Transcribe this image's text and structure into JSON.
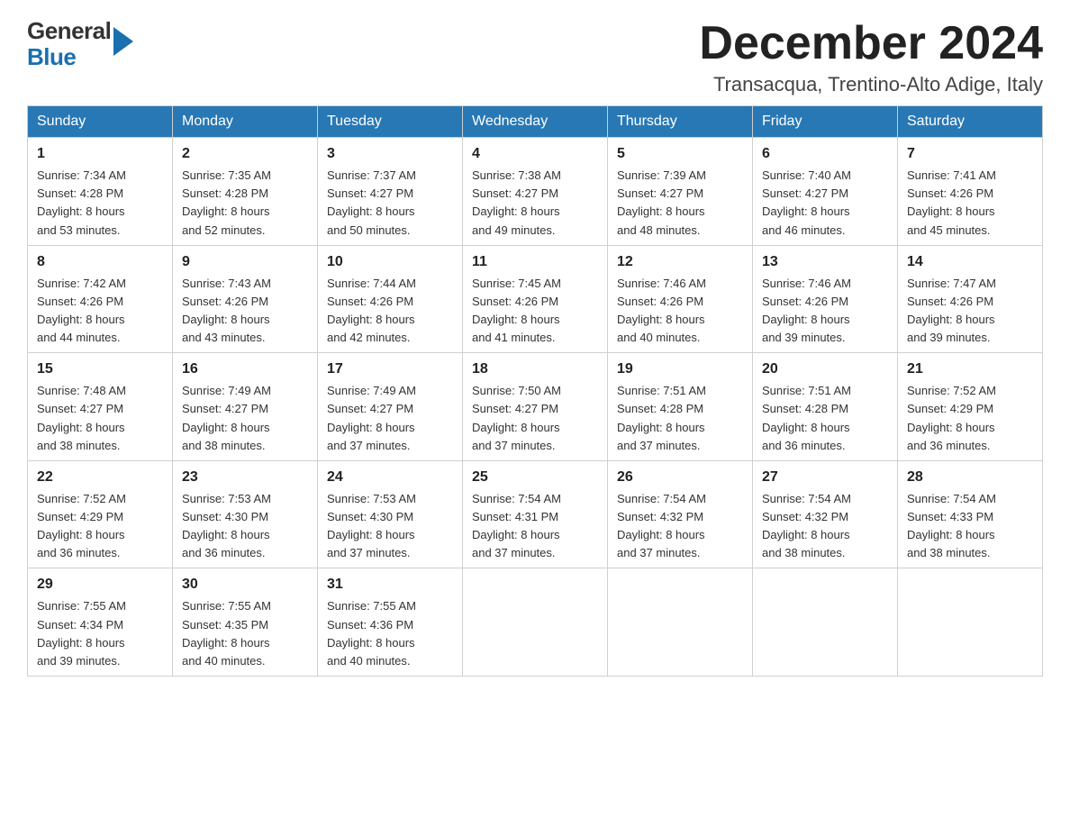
{
  "logo": {
    "line1": "General",
    "line2": "Blue"
  },
  "header": {
    "month": "December 2024",
    "location": "Transacqua, Trentino-Alto Adige, Italy"
  },
  "days_of_week": [
    "Sunday",
    "Monday",
    "Tuesday",
    "Wednesday",
    "Thursday",
    "Friday",
    "Saturday"
  ],
  "weeks": [
    [
      {
        "date": "1",
        "sunrise": "7:34 AM",
        "sunset": "4:28 PM",
        "daylight": "8 hours and 53 minutes."
      },
      {
        "date": "2",
        "sunrise": "7:35 AM",
        "sunset": "4:28 PM",
        "daylight": "8 hours and 52 minutes."
      },
      {
        "date": "3",
        "sunrise": "7:37 AM",
        "sunset": "4:27 PM",
        "daylight": "8 hours and 50 minutes."
      },
      {
        "date": "4",
        "sunrise": "7:38 AM",
        "sunset": "4:27 PM",
        "daylight": "8 hours and 49 minutes."
      },
      {
        "date": "5",
        "sunrise": "7:39 AM",
        "sunset": "4:27 PM",
        "daylight": "8 hours and 48 minutes."
      },
      {
        "date": "6",
        "sunrise": "7:40 AM",
        "sunset": "4:27 PM",
        "daylight": "8 hours and 46 minutes."
      },
      {
        "date": "7",
        "sunrise": "7:41 AM",
        "sunset": "4:26 PM",
        "daylight": "8 hours and 45 minutes."
      }
    ],
    [
      {
        "date": "8",
        "sunrise": "7:42 AM",
        "sunset": "4:26 PM",
        "daylight": "8 hours and 44 minutes."
      },
      {
        "date": "9",
        "sunrise": "7:43 AM",
        "sunset": "4:26 PM",
        "daylight": "8 hours and 43 minutes."
      },
      {
        "date": "10",
        "sunrise": "7:44 AM",
        "sunset": "4:26 PM",
        "daylight": "8 hours and 42 minutes."
      },
      {
        "date": "11",
        "sunrise": "7:45 AM",
        "sunset": "4:26 PM",
        "daylight": "8 hours and 41 minutes."
      },
      {
        "date": "12",
        "sunrise": "7:46 AM",
        "sunset": "4:26 PM",
        "daylight": "8 hours and 40 minutes."
      },
      {
        "date": "13",
        "sunrise": "7:46 AM",
        "sunset": "4:26 PM",
        "daylight": "8 hours and 39 minutes."
      },
      {
        "date": "14",
        "sunrise": "7:47 AM",
        "sunset": "4:26 PM",
        "daylight": "8 hours and 39 minutes."
      }
    ],
    [
      {
        "date": "15",
        "sunrise": "7:48 AM",
        "sunset": "4:27 PM",
        "daylight": "8 hours and 38 minutes."
      },
      {
        "date": "16",
        "sunrise": "7:49 AM",
        "sunset": "4:27 PM",
        "daylight": "8 hours and 38 minutes."
      },
      {
        "date": "17",
        "sunrise": "7:49 AM",
        "sunset": "4:27 PM",
        "daylight": "8 hours and 37 minutes."
      },
      {
        "date": "18",
        "sunrise": "7:50 AM",
        "sunset": "4:27 PM",
        "daylight": "8 hours and 37 minutes."
      },
      {
        "date": "19",
        "sunrise": "7:51 AM",
        "sunset": "4:28 PM",
        "daylight": "8 hours and 37 minutes."
      },
      {
        "date": "20",
        "sunrise": "7:51 AM",
        "sunset": "4:28 PM",
        "daylight": "8 hours and 36 minutes."
      },
      {
        "date": "21",
        "sunrise": "7:52 AM",
        "sunset": "4:29 PM",
        "daylight": "8 hours and 36 minutes."
      }
    ],
    [
      {
        "date": "22",
        "sunrise": "7:52 AM",
        "sunset": "4:29 PM",
        "daylight": "8 hours and 36 minutes."
      },
      {
        "date": "23",
        "sunrise": "7:53 AM",
        "sunset": "4:30 PM",
        "daylight": "8 hours and 36 minutes."
      },
      {
        "date": "24",
        "sunrise": "7:53 AM",
        "sunset": "4:30 PM",
        "daylight": "8 hours and 37 minutes."
      },
      {
        "date": "25",
        "sunrise": "7:54 AM",
        "sunset": "4:31 PM",
        "daylight": "8 hours and 37 minutes."
      },
      {
        "date": "26",
        "sunrise": "7:54 AM",
        "sunset": "4:32 PM",
        "daylight": "8 hours and 37 minutes."
      },
      {
        "date": "27",
        "sunrise": "7:54 AM",
        "sunset": "4:32 PM",
        "daylight": "8 hours and 38 minutes."
      },
      {
        "date": "28",
        "sunrise": "7:54 AM",
        "sunset": "4:33 PM",
        "daylight": "8 hours and 38 minutes."
      }
    ],
    [
      {
        "date": "29",
        "sunrise": "7:55 AM",
        "sunset": "4:34 PM",
        "daylight": "8 hours and 39 minutes."
      },
      {
        "date": "30",
        "sunrise": "7:55 AM",
        "sunset": "4:35 PM",
        "daylight": "8 hours and 40 minutes."
      },
      {
        "date": "31",
        "sunrise": "7:55 AM",
        "sunset": "4:36 PM",
        "daylight": "8 hours and 40 minutes."
      },
      null,
      null,
      null,
      null
    ]
  ],
  "labels": {
    "sunrise": "Sunrise:",
    "sunset": "Sunset:",
    "daylight": "Daylight:"
  }
}
